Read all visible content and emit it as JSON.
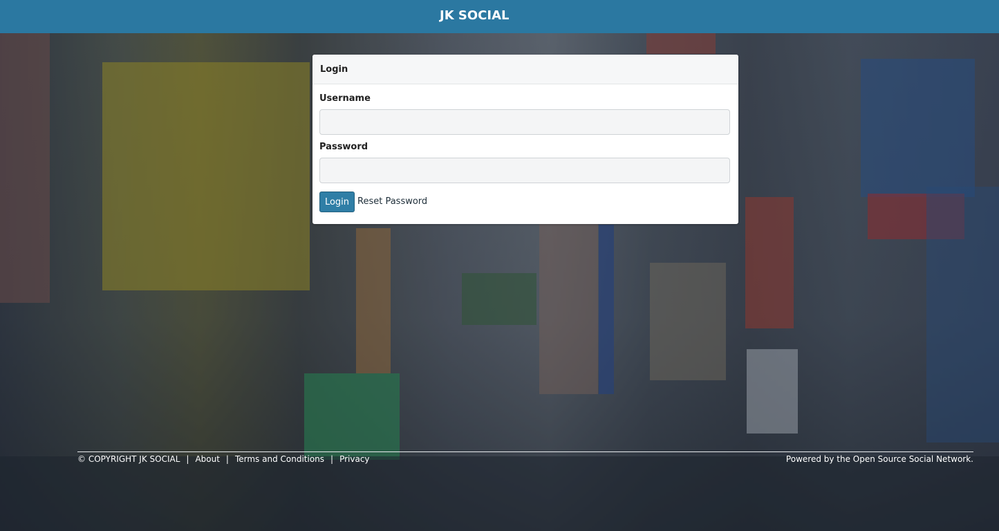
{
  "header": {
    "brand": "JK SOCIAL"
  },
  "login": {
    "title": "Login",
    "username_label": "Username",
    "username_value": "",
    "password_label": "Password",
    "password_value": "",
    "submit_label": "Login",
    "reset_label": "Reset Password"
  },
  "footer": {
    "copyright": "© COPYRIGHT JK SOCIAL",
    "separator": "|",
    "links": [
      "About",
      "Terms and Conditions",
      "Privacy"
    ],
    "powered_by": "Powered by the Open Source Social Network."
  },
  "colors": {
    "topbar": "#2b78a1",
    "button": "#2f7ea6"
  }
}
